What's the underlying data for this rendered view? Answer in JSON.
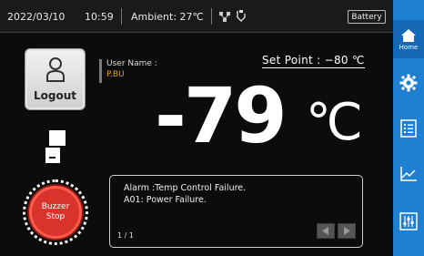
{
  "status_bar": {
    "date": "2022/03/10",
    "time": "10:59",
    "ambient": "Ambient: 27℃",
    "battery_label": "Battery"
  },
  "user": {
    "label": "User Name :",
    "name": "P.BU"
  },
  "logout_label": "Logout",
  "set_point": "Set Point : −80 ℃",
  "temperature": {
    "value": "-79",
    "unit": "℃"
  },
  "buzzer": {
    "line1": "Buzzer",
    "line2": "Stop"
  },
  "alarm": {
    "messages": [
      "Alarm :Temp Control Failure.",
      "A01: Power Failure."
    ],
    "page": "1 / 1"
  },
  "nav": {
    "home_label": "Home",
    "items": [
      "home-icon",
      "gear-icon",
      "list-icon",
      "chart-icon",
      "adjust-icon"
    ]
  },
  "colors": {
    "nav_bg": "#1f7fd1",
    "user_name": "#e6a21c",
    "buzzer": "#d8342c"
  }
}
